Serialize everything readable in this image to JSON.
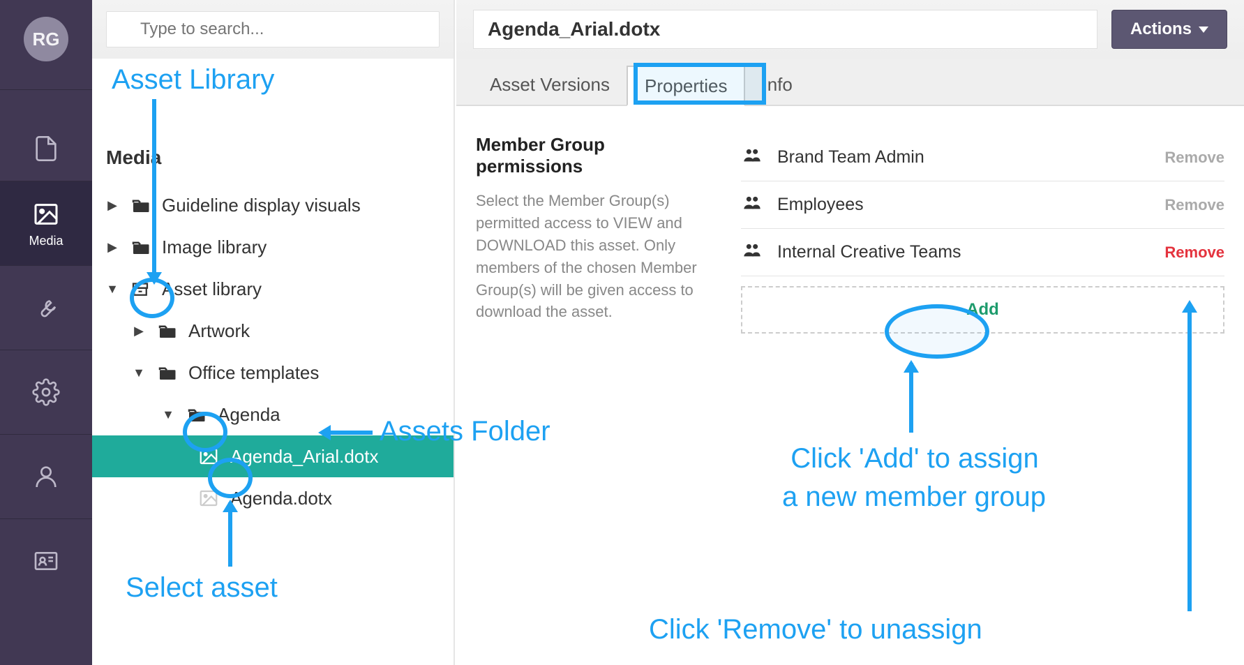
{
  "rail": {
    "avatar_initials": "RG",
    "media_label": "Media"
  },
  "sidebar": {
    "search_placeholder": "Type to search...",
    "heading": "Media",
    "items": [
      {
        "label": "Guideline display visuals"
      },
      {
        "label": "Image library"
      },
      {
        "label": "Asset library"
      },
      {
        "label": "Artwork"
      },
      {
        "label": "Office templates"
      },
      {
        "label": "Agenda"
      },
      {
        "label": "Agenda_Arial.dotx"
      },
      {
        "label": "Agenda.dotx"
      }
    ]
  },
  "main": {
    "title_value": "Agenda_Arial.dotx",
    "actions_label": "Actions",
    "tabs": {
      "versions": "Asset Versions",
      "properties": "Properties",
      "info": "Info"
    },
    "perm_title": "Member Group permissions",
    "perm_text": "Select the Member Group(s) permitted access to VIEW and DOWNLOAD this asset. Only members of the chosen Member Group(s) will be given access to download the asset.",
    "groups": [
      {
        "name": "Brand Team Admin",
        "remove": "Remove"
      },
      {
        "name": "Employees",
        "remove": "Remove"
      },
      {
        "name": "Internal Creative Teams",
        "remove": "Remove"
      }
    ],
    "add_label": "Add"
  },
  "annotations": {
    "asset_library": "Asset Library",
    "assets_folder": "Assets Folder",
    "select_asset": "Select asset",
    "add_text_l1": "Click 'Add' to assign",
    "add_text_l2": "a new member group",
    "remove_text": "Click 'Remove' to unassign"
  }
}
